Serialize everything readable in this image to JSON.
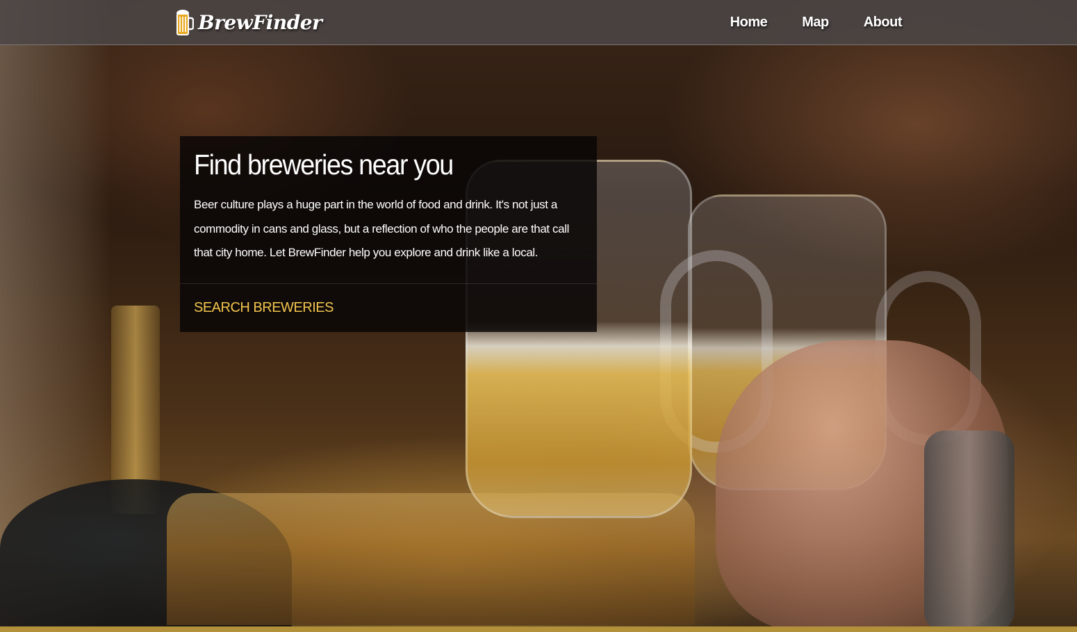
{
  "brand": {
    "name": "BrewFinder",
    "icon": "beer-mug-icon"
  },
  "nav": {
    "items": [
      {
        "label": "Home"
      },
      {
        "label": "Map"
      },
      {
        "label": "About"
      }
    ]
  },
  "hero": {
    "title": "Find breweries near you",
    "text": "Beer culture plays a huge part in the world of food and drink. It's not just a commodity in cans and glass, but a reflection of who the people are that call that city home. Let BrewFinder help you explore and drink like a local.",
    "action_label": "SEARCH BREWERIES"
  },
  "colors": {
    "accent": "#f2c44e",
    "navbar": "#4b4646",
    "card": "#080606",
    "bottom_strip": "#b3913b"
  }
}
